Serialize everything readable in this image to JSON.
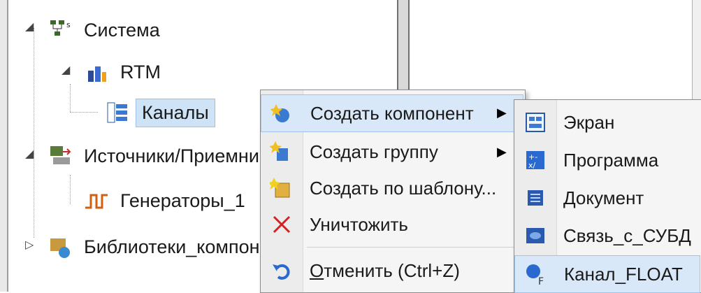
{
  "tree": {
    "nodes": [
      {
        "label": "Система",
        "icon": "system-network-icon"
      },
      {
        "label": "RTM",
        "icon": "rtm-icon"
      },
      {
        "label": "Каналы",
        "icon": "channels-icon"
      },
      {
        "label": "Источники/Приемни",
        "icon": "sources-receivers-icon"
      },
      {
        "label": "Генераторы_1",
        "icon": "generator-wave-icon"
      },
      {
        "label": "Библиотеки_компон",
        "icon": "libraries-icon"
      }
    ]
  },
  "context_menu": {
    "items": [
      {
        "label": "Создать компонент",
        "icon": "create-component-icon"
      },
      {
        "label": "Создать группу",
        "icon": "create-group-icon"
      },
      {
        "label": "Создать по шаблону...",
        "icon": "create-from-template-icon"
      },
      {
        "label": "Уничтожить",
        "icon": "delete-x-icon"
      },
      {
        "label_u": "О",
        "label_rest": "тменить (Ctrl+Z)",
        "icon": "undo-icon"
      }
    ]
  },
  "submenu": {
    "items": [
      {
        "label": "Экран",
        "icon": "screen-icon"
      },
      {
        "label": "Программа",
        "icon": "program-icon"
      },
      {
        "label": "Документ",
        "icon": "document-icon"
      },
      {
        "label": "Связь_с_СУБД",
        "icon": "dbms-link-icon"
      },
      {
        "label": "Канал_FLOAT",
        "icon": "channel-float-icon"
      }
    ]
  },
  "colors": {
    "selection": "#cfe3f7",
    "menu_highlight": "#d9e8f8",
    "delete_red": "#d42020"
  }
}
